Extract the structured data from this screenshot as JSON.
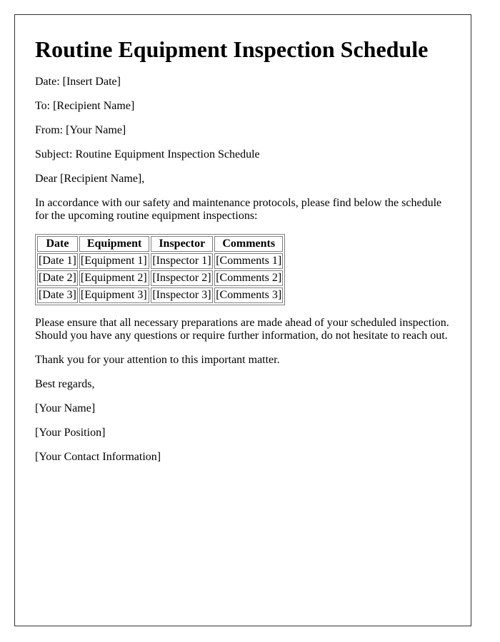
{
  "title": "Routine Equipment Inspection Schedule",
  "header_fields": {
    "date": "Date: [Insert Date]",
    "to": "To: [Recipient Name]",
    "from": "From: [Your Name]",
    "subject": "Subject: Routine Equipment Inspection Schedule"
  },
  "salutation": "Dear [Recipient Name],",
  "intro": "In accordance with our safety and maintenance protocols, please find below the schedule for the upcoming routine equipment inspections:",
  "table": {
    "headers": [
      "Date",
      "Equipment",
      "Inspector",
      "Comments"
    ],
    "rows": [
      [
        "[Date 1]",
        "[Equipment 1]",
        "[Inspector 1]",
        "[Comments 1]"
      ],
      [
        "[Date 2]",
        "[Equipment 2]",
        "[Inspector 2]",
        "[Comments 2]"
      ],
      [
        "[Date 3]",
        "[Equipment 3]",
        "[Inspector 3]",
        "[Comments 3]"
      ]
    ]
  },
  "body_paragraph": "Please ensure that all necessary preparations are made ahead of your scheduled inspection. Should you have any questions or require further information, do not hesitate to reach out.",
  "thanks": "Thank you for your attention to this important matter.",
  "closing": "Best regards,",
  "signature": {
    "name": "[Your Name]",
    "position": "[Your Position]",
    "contact": "[Your Contact Information]"
  }
}
